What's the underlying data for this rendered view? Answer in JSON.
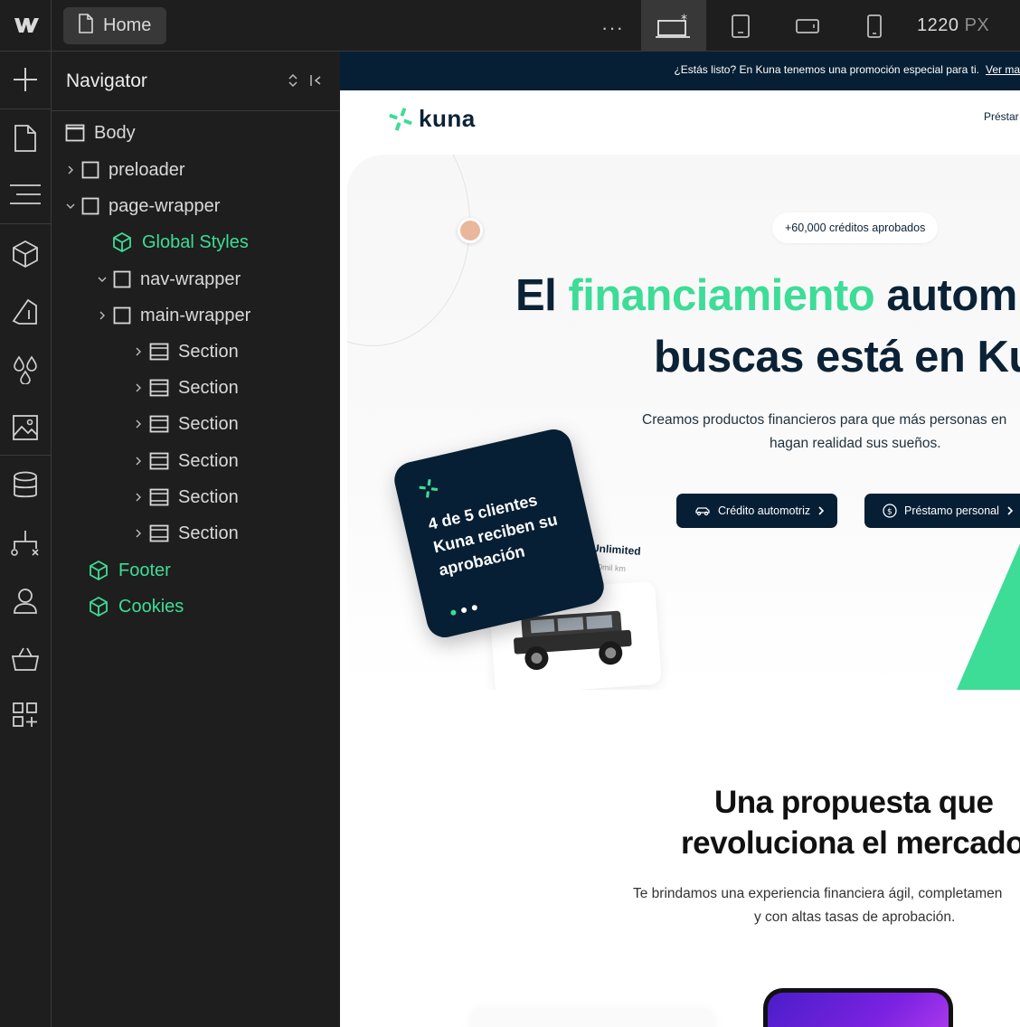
{
  "topbar": {
    "page_name": "Home",
    "more_label": "···",
    "width_value": "1220",
    "width_unit": "PX"
  },
  "navigator": {
    "title": "Navigator",
    "items": [
      {
        "label": "Body",
        "kind": "body"
      },
      {
        "label": "preloader",
        "kind": "element"
      },
      {
        "label": "page-wrapper",
        "kind": "element"
      },
      {
        "label": "Global Styles",
        "kind": "component"
      },
      {
        "label": "nav-wrapper",
        "kind": "element"
      },
      {
        "label": "main-wrapper",
        "kind": "element"
      },
      {
        "label": "Section",
        "kind": "section"
      },
      {
        "label": "Section",
        "kind": "section"
      },
      {
        "label": "Section",
        "kind": "section"
      },
      {
        "label": "Section",
        "kind": "section"
      },
      {
        "label": "Section",
        "kind": "section"
      },
      {
        "label": "Section",
        "kind": "section"
      },
      {
        "label": "Footer",
        "kind": "component"
      },
      {
        "label": "Cookies",
        "kind": "component"
      }
    ]
  },
  "site": {
    "promo_text": "¿Estás listo? En Kuna tenemos una promoción especial para ti.",
    "promo_link": "Ver ma",
    "brand": "kuna",
    "nav_link": "Préstar",
    "badge": "+60,000 créditos aprobados",
    "headline_part1": "El ",
    "headline_accent": "financiamiento",
    "headline_part2": " autom",
    "headline_line2": "buscas está en Kur",
    "subtitle_line1": "Creamos productos financieros para que más personas en",
    "subtitle_line2": "hagan realidad sus sueños.",
    "cta1": "Crédito automotriz",
    "cta2": "Préstamo personal",
    "card_line1": "4 de 5 clientes",
    "card_line2": "Kuna reciben su",
    "card_line3": "aprobación",
    "car_label": "Unlimited",
    "car_sub": "40mil km",
    "section2_line1": "Una propuesta que",
    "section2_line2": "revoluciona el mercado",
    "section2_p1": "Te brindamos una experiencia financiera ágil, completamen",
    "section2_p2": "y con altas tasas de aprobación."
  },
  "colors": {
    "accent": "#3ddc97",
    "navy": "#071f34",
    "editor_bg": "#1e1e1e"
  }
}
